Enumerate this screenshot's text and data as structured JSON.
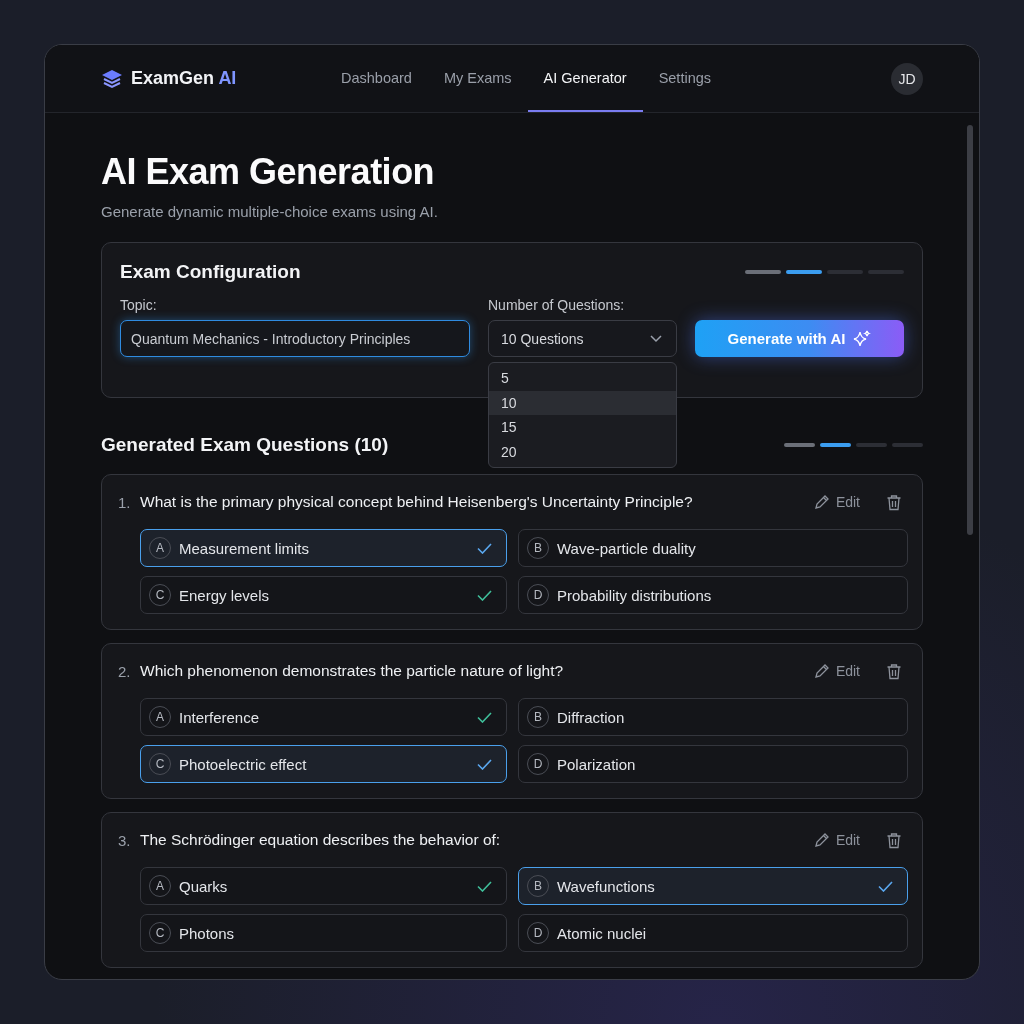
{
  "app": {
    "logo_name": "ExamGen",
    "logo_accent": "AI"
  },
  "nav": [
    {
      "label": "Dashboard",
      "selected": false
    },
    {
      "label": "My Exams",
      "selected": false
    },
    {
      "label": "AI Generator",
      "selected": true
    },
    {
      "label": "Settings",
      "selected": false
    }
  ],
  "user": {
    "initials": "JD"
  },
  "page": {
    "title": "AI Exam Generation",
    "subtitle": "Generate dynamic multiple-choice exams using AI."
  },
  "config": {
    "title": "Exam Configuration",
    "steps": [
      {
        "completed": true,
        "selected": false
      },
      {
        "completed": false,
        "selected": true
      },
      {
        "completed": false,
        "selected": false
      },
      {
        "completed": false,
        "selected": false
      }
    ],
    "topic_label": "Topic:",
    "topic_value": "Quantum Mechanics - Introductory Principles",
    "count_label": "Number of Questions:",
    "count_value": "10 Questions",
    "dropdown_open": true,
    "count_options": [
      {
        "label": "5",
        "selected": false
      },
      {
        "label": "10",
        "selected": true
      },
      {
        "label": "15",
        "selected": false
      },
      {
        "label": "20",
        "selected": false
      }
    ],
    "generate_button": "Generate with AI"
  },
  "questions_section": {
    "title": "Generated Exam Questions (10)",
    "steps": [
      {
        "completed": true,
        "selected": false
      },
      {
        "completed": false,
        "selected": true
      },
      {
        "completed": false,
        "selected": false
      },
      {
        "completed": false,
        "selected": false
      }
    ],
    "questions": [
      {
        "number": "1.",
        "edit_label": "Edit",
        "text": "What is the primary physical concept behind Heisenberg's Uncertainty Principle?",
        "options": [
          {
            "letter": "A",
            "text": "Measurement limits",
            "selected": true,
            "checked": true
          },
          {
            "letter": "B",
            "text": "Wave-particle duality",
            "selected": false,
            "checked": false
          },
          {
            "letter": "C",
            "text": "Energy levels",
            "selected": false,
            "checked": true
          },
          {
            "letter": "D",
            "text": "Probability distributions",
            "selected": false,
            "checked": false
          }
        ]
      },
      {
        "number": "2.",
        "edit_label": "Edit",
        "text": "Which phenomenon demonstrates the particle nature of light?",
        "options": [
          {
            "letter": "A",
            "text": "Interference",
            "selected": false,
            "checked": true
          },
          {
            "letter": "B",
            "text": "Diffraction",
            "selected": false,
            "checked": false
          },
          {
            "letter": "C",
            "text": "Photoelectric effect",
            "selected": true,
            "checked": true
          },
          {
            "letter": "D",
            "text": "Polarization",
            "selected": false,
            "checked": false
          }
        ]
      },
      {
        "number": "3.",
        "edit_label": "Edit",
        "text": "The Schrödinger equation describes the behavior of:",
        "options": [
          {
            "letter": "A",
            "text": "Quarks",
            "selected": false,
            "checked": true
          },
          {
            "letter": "B",
            "text": "Wavefunctions",
            "selected": true,
            "checked": true
          },
          {
            "letter": "C",
            "text": "Photons",
            "selected": false,
            "checked": false
          },
          {
            "letter": "D",
            "text": "Atomic nuclei",
            "selected": false,
            "checked": false
          }
        ]
      }
    ]
  }
}
